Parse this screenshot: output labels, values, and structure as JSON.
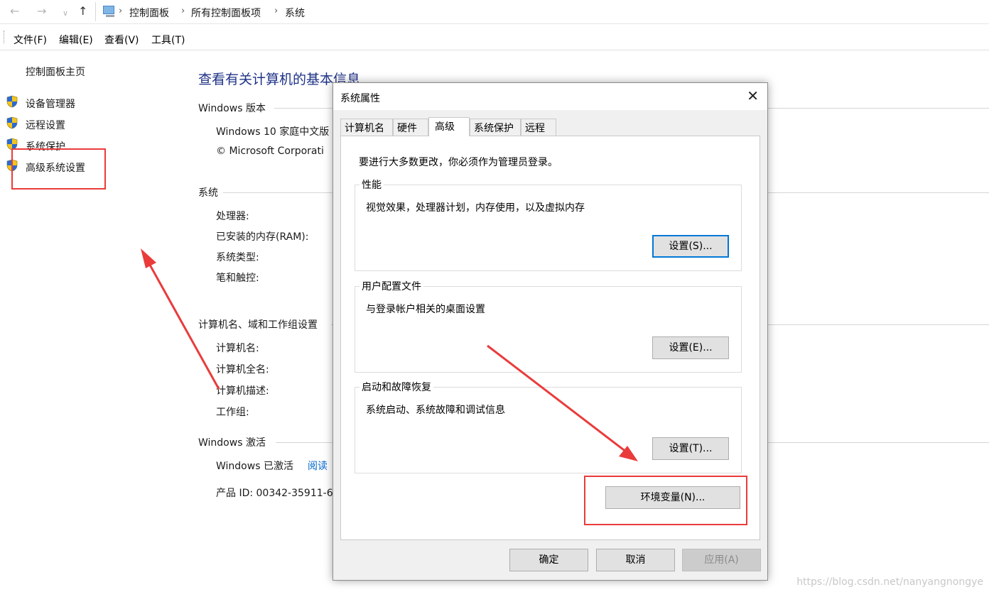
{
  "address_bar": {
    "back_icon": "back-arrow-icon",
    "forward_icon": "forward-arrow-icon",
    "up_icon": "up-arrow-icon",
    "breadcrumbs": [
      "控制面板",
      "所有控制面板项",
      "系统"
    ]
  },
  "menu": {
    "items": [
      "文件(F)",
      "编辑(E)",
      "查看(V)",
      "工具(T)"
    ]
  },
  "left_pane": {
    "home_link": "控制面板主页",
    "links": [
      "设备管理器",
      "远程设置",
      "系统保护",
      "高级系统设置"
    ]
  },
  "main": {
    "heading": "查看有关计算机的基本信息",
    "windows_edition": {
      "title": "Windows 版本",
      "edition": "Windows 10 家庭中文版",
      "copyright": "© Microsoft Corporati"
    },
    "system": {
      "title": "系统",
      "fields": [
        "处理器:",
        "已安装的内存(RAM):",
        "系统类型:",
        "笔和触控:"
      ]
    },
    "computer_name": {
      "title": "计算机名、域和工作组设置",
      "fields": [
        "计算机名:",
        "计算机全名:",
        "计算机描述:",
        "工作组:"
      ]
    },
    "activation": {
      "title": "Windows 激活",
      "status": "Windows 已激活",
      "read_link": "阅读",
      "product_id": "产品 ID: 00342-35911-6"
    }
  },
  "dialog": {
    "title": "系统属性",
    "close_icon": "close-icon",
    "tabs": [
      "计算机名",
      "硬件",
      "高级",
      "系统保护",
      "远程"
    ],
    "active_tab": "高级",
    "admin_note": "要进行大多数更改，你必须作为管理员登录。",
    "groups": [
      {
        "title": "性能",
        "description": "视觉效果，处理器计划，内存使用，以及虚拟内存",
        "button": "设置(S)..."
      },
      {
        "title": "用户配置文件",
        "description": "与登录帐户相关的桌面设置",
        "button": "设置(E)..."
      },
      {
        "title": "启动和故障恢复",
        "description": "系统启动、系统故障和调试信息",
        "button": "设置(T)..."
      }
    ],
    "env_button": "环境变量(N)...",
    "ok_button": "确定",
    "cancel_button": "取消",
    "apply_button": "应用(A)"
  },
  "annotations": {
    "highlight_color": "#ea3b3b"
  },
  "watermark": "https://blog.csdn.net/nanyangnongye"
}
